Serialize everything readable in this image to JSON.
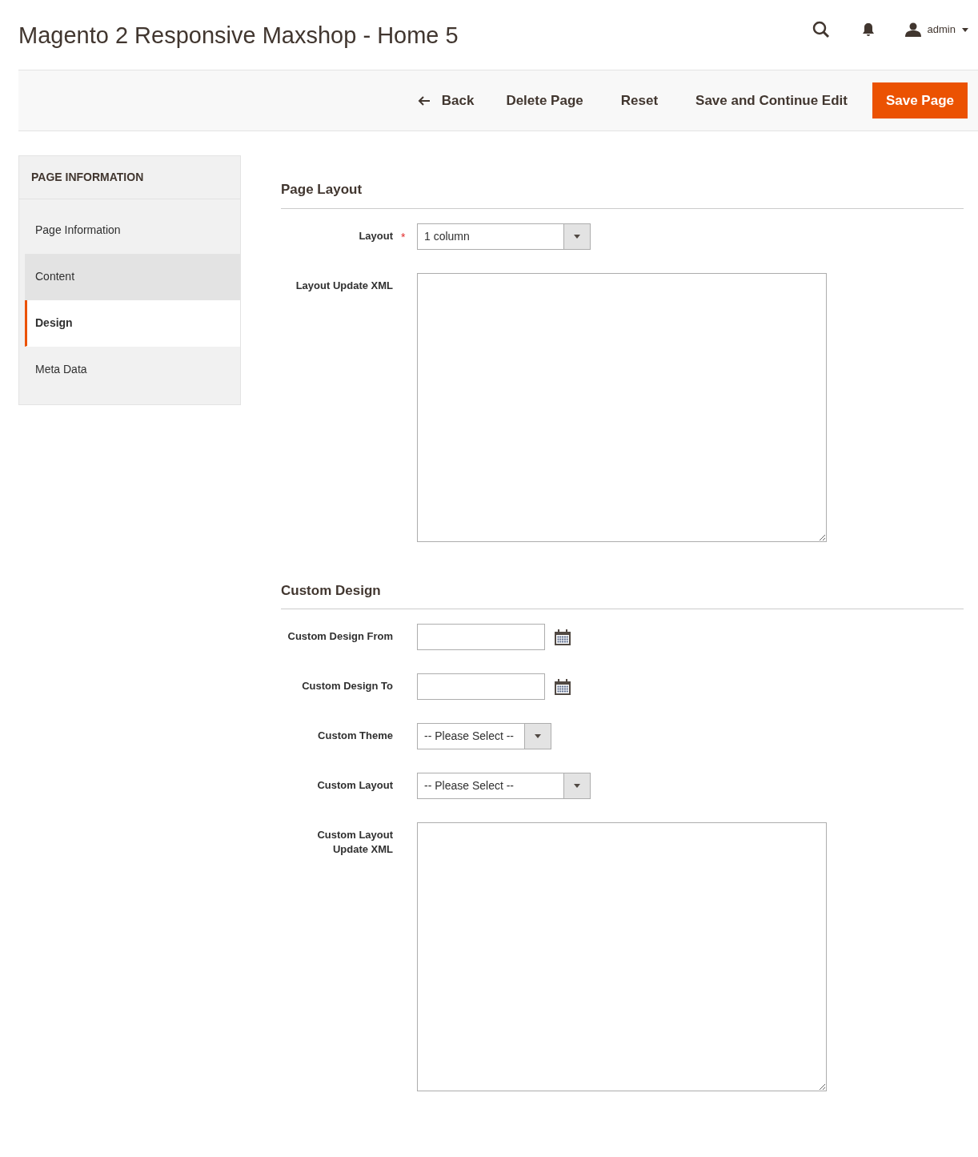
{
  "title": "Magento 2 Responsive Maxshop - Home 5",
  "header": {
    "user": "admin"
  },
  "actions": [
    {
      "label": "Back",
      "kind": "back"
    },
    {
      "label": "Delete Page",
      "kind": "plain"
    },
    {
      "label": "Reset",
      "kind": "plain"
    },
    {
      "label": "Save and Continue Edit",
      "kind": "plain"
    },
    {
      "label": "Save Page",
      "kind": "primary"
    }
  ],
  "sidebar": {
    "heading": "PAGE INFORMATION",
    "items": [
      {
        "label": "Page Information",
        "selected": false,
        "hovered": false
      },
      {
        "label": "Content",
        "selected": false,
        "hovered": true
      },
      {
        "label": "Design",
        "selected": true,
        "hovered": false
      },
      {
        "label": "Meta Data",
        "selected": false,
        "hovered": false
      }
    ]
  },
  "sections": [
    {
      "title": "Page Layout",
      "fields": [
        {
          "label": "Layout",
          "kind": "select",
          "required_mark": "*",
          "value": "1 column",
          "wide": true
        },
        {
          "label": "Layout Update XML",
          "kind": "textarea"
        }
      ]
    },
    {
      "title": "Custom Design",
      "fields": [
        {
          "label": "Custom Design From",
          "kind": "date"
        },
        {
          "label": "Custom Design To",
          "kind": "date"
        },
        {
          "label": "Custom Theme",
          "kind": "select",
          "value": "-- Please Select --",
          "wide": false
        },
        {
          "label": "Custom Layout",
          "kind": "select",
          "value": "-- Please Select --",
          "wide": true
        },
        {
          "label": "Custom Layout Update XML",
          "kind": "textarea"
        }
      ]
    }
  ]
}
